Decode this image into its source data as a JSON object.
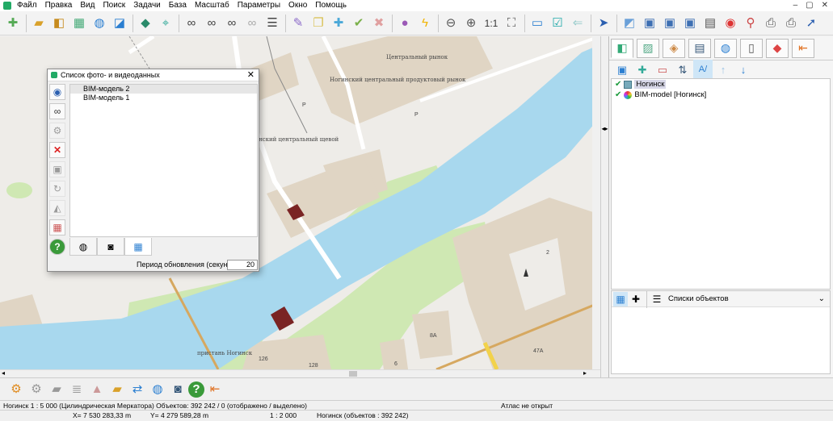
{
  "menu": [
    "Файл",
    "Правка",
    "Вид",
    "Поиск",
    "Задачи",
    "База",
    "Масштаб",
    "Параметры",
    "Окно",
    "Помощь"
  ],
  "window_controls": [
    "–",
    "▢",
    "✕"
  ],
  "toolbar": [
    "new-document-icon",
    "open-folder-icon",
    "layers-icon",
    "bim-icon",
    "globe-refresh-icon",
    "globe-doc-icon",
    "layers-stack-icon",
    "select-cursor-icon",
    "binoculars-icon",
    "binoculars-a-icon",
    "binoculars-dots-icon",
    "binoculars-gray-icon",
    "list-icon",
    "edit-object-icon",
    "copy-object-icon",
    "add-object-icon",
    "check-object-icon",
    "delete-object-icon",
    "ball-icon",
    "lightning-icon",
    "zoom-out-icon",
    "zoom-in-icon",
    "scale-1-1-icon",
    "fit-view-icon",
    "frame-icon",
    "check-frame-icon",
    "back-arrow-icon",
    "pointer-icon",
    "map-info-icon",
    "map-monitor-icon",
    "map-monitor2-icon",
    "map-monitor3-icon",
    "text-a-icon",
    "color-wheel-icon",
    "pin-route-icon",
    "printer-icon",
    "printer2-icon",
    "help-pointer-icon"
  ],
  "map": {
    "labels": {
      "market": "Центральный рынок",
      "food_market": "Ногинский центральный продуктовый рынок",
      "central": "нский центральный щевой",
      "building_2": "2",
      "building_8a": "8А",
      "building_47a": "47А",
      "building_126": "126",
      "building_128": "128",
      "building_6": "6",
      "pier": "пристань Ногинск",
      "letter_p": "Р",
      "letter_p2": "Р"
    },
    "colors": {
      "river": "#a8d8ee",
      "green": "#cfe8b3",
      "building": "#e0d5c4",
      "road": "#ffffff",
      "bim_object": "#7a2424"
    }
  },
  "dialog": {
    "title": "Список фото- и видеоданных",
    "close": "✕",
    "items": [
      "BIM-модель 2",
      "BIM-модель 1"
    ],
    "period_label": "Период обновления (секунды)",
    "period_value": "20",
    "tabs": [
      "camera-icon",
      "photo-icon",
      "bim-tab-icon"
    ]
  },
  "right_panel": {
    "tree": [
      {
        "label": "Ногинск"
      },
      {
        "label": "BIM-model [Ногинск]"
      }
    ],
    "objects_label": "Списки объектов"
  },
  "bottom_tools": [
    "settings-gear-icon",
    "gear-cam-icon",
    "folder-icon",
    "database-icon",
    "shape-icon",
    "folder-open-icon",
    "data-sync-icon",
    "camera-sync-icon",
    "camera-doc-icon",
    "help-icon",
    "exit-icon"
  ],
  "status": {
    "line1_left": "Ногинск   1 : 5 000 (Цилиндрическая Меркатора) Объектов: 392 242 / 0 (отображено / выделено)",
    "line1_right": "Атлас не открыт",
    "x": "X= 7 530 283,33 m",
    "y": "Y= 4 279 589,28 m",
    "scale": "1 : 2 000",
    "objects": "Ногинск   (объектов : 392 242)"
  }
}
